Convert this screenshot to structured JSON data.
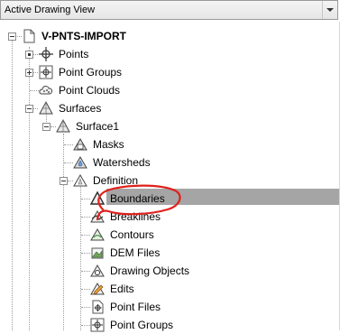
{
  "view_selector": {
    "value": "Active Drawing View"
  },
  "tree": {
    "root": "V-PNTS-IMPORT",
    "points": "Points",
    "point_groups": "Point Groups",
    "point_clouds": "Point Clouds",
    "surfaces": "Surfaces",
    "surface1": "Surface1",
    "masks": "Masks",
    "watersheds": "Watersheds",
    "definition": "Definition",
    "boundaries": "Boundaries",
    "breaklines": "Breaklines",
    "contours": "Contours",
    "dem_files": "DEM Files",
    "drawing_objects": "Drawing Objects",
    "edits": "Edits",
    "point_files": "Point Files",
    "point_groups_def": "Point Groups"
  },
  "colors": {
    "selection": "#a5a5a5",
    "annotation": "#e0201b"
  }
}
